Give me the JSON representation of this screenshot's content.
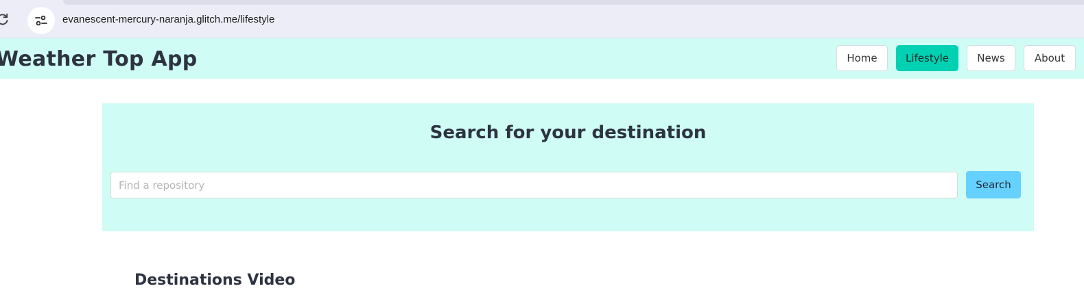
{
  "browser": {
    "url": "evanescent-mercury-naranja.glitch.me/lifestyle",
    "reload_icon": "reload-icon",
    "site_info_icon": "tune-icon"
  },
  "header": {
    "title": "Weather Top App",
    "nav": [
      {
        "label": "Home",
        "active": false
      },
      {
        "label": "Lifestyle",
        "active": true
      },
      {
        "label": "News",
        "active": false
      },
      {
        "label": "About",
        "active": false
      }
    ]
  },
  "search": {
    "heading": "Search for your destination",
    "placeholder": "Find a repository",
    "value": "",
    "button_label": "Search"
  },
  "sections": {
    "videos_heading": "Destinations Video"
  },
  "colors": {
    "header_bg": "#cffcf5",
    "active_nav": "#00d1b2",
    "search_button": "#66d1ff",
    "text_dark": "#2d3340"
  }
}
